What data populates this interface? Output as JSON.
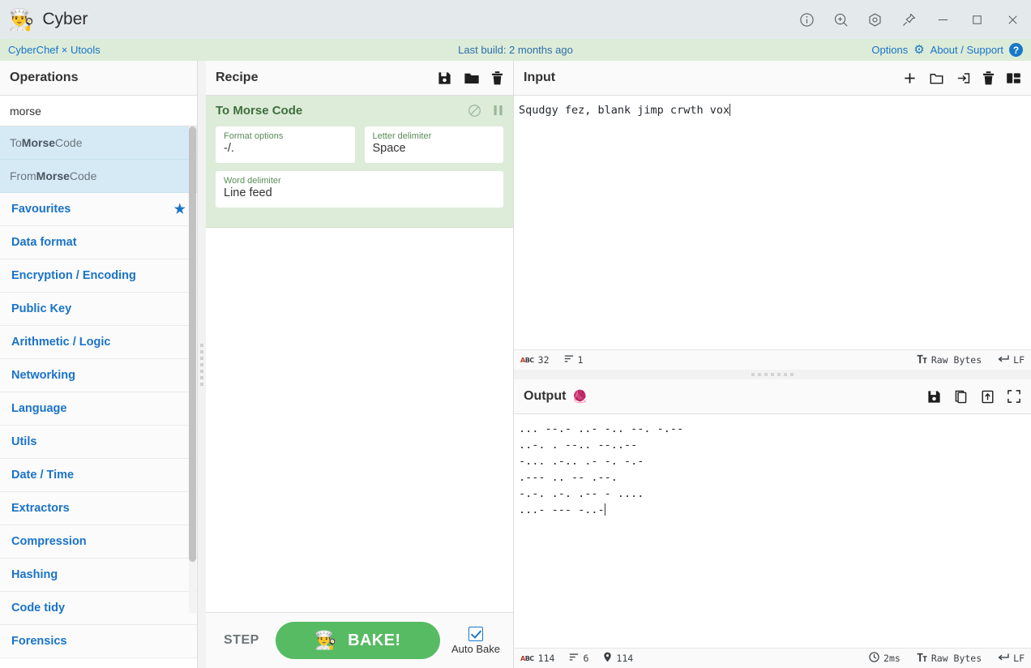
{
  "titlebar": {
    "app_name": "Cyber",
    "logo_icon": "chef-icon",
    "buttons": [
      {
        "name": "info-icon",
        "label": "Info"
      },
      {
        "name": "zoom-in-icon",
        "label": "Zoom"
      },
      {
        "name": "settings-icon",
        "label": "Settings"
      },
      {
        "name": "pin-icon",
        "label": "Pin"
      },
      {
        "name": "minimize-icon",
        "label": "Minimize"
      },
      {
        "name": "maximize-icon",
        "label": "Maximize"
      },
      {
        "name": "close-icon",
        "label": "Close"
      }
    ]
  },
  "subbar": {
    "brand": "CyberChef × Utools",
    "build": "Last build: 2 months ago",
    "options": "Options",
    "about": "About / Support",
    "background": "#ddecd9",
    "link_color": "#1a73c8"
  },
  "operations": {
    "title": "Operations",
    "search_value": "morse",
    "search_placeholder": "Search...",
    "results": [
      {
        "prefix": "To ",
        "match": "Morse",
        "suffix": " Code"
      },
      {
        "prefix": "From ",
        "match": "Morse",
        "suffix": " Code"
      }
    ],
    "categories": [
      {
        "label": "Favourites",
        "icon": "star-icon"
      },
      {
        "label": "Data format"
      },
      {
        "label": "Encryption / Encoding"
      },
      {
        "label": "Public Key"
      },
      {
        "label": "Arithmetic / Logic"
      },
      {
        "label": "Networking"
      },
      {
        "label": "Language"
      },
      {
        "label": "Utils"
      },
      {
        "label": "Date / Time"
      },
      {
        "label": "Extractors"
      },
      {
        "label": "Compression"
      },
      {
        "label": "Hashing"
      },
      {
        "label": "Code tidy"
      },
      {
        "label": "Forensics"
      }
    ]
  },
  "recipe": {
    "title": "Recipe",
    "icons": [
      {
        "name": "save-recipe-icon"
      },
      {
        "name": "load-recipe-icon"
      },
      {
        "name": "clear-recipe-icon"
      }
    ],
    "operation": {
      "name": "To Morse Code",
      "disable_icon": "disable-icon",
      "breakpoint_icon": "breakpoint-icon",
      "args": [
        {
          "label": "Format options",
          "value": "-/."
        },
        {
          "label": "Letter delimiter",
          "value": "Space"
        },
        {
          "label": "Word delimiter",
          "value": "Line feed"
        }
      ]
    },
    "controls": {
      "step": "STEP",
      "bake": "BAKE!",
      "bake_emoji": "chef-icon",
      "auto_bake": "Auto Bake",
      "auto_bake_checked": true,
      "bake_color": "#57bb63"
    }
  },
  "input": {
    "title": "Input",
    "icons": [
      {
        "name": "add-input-tab-icon"
      },
      {
        "name": "open-folder-icon"
      },
      {
        "name": "open-input-icon"
      },
      {
        "name": "clear-input-icon"
      },
      {
        "name": "reset-layout-icon"
      }
    ],
    "value": "Squdgy fez, blank jimp crwth vox",
    "status": {
      "length_icon": "abc-icon",
      "length": "32",
      "lines_icon": "lines-icon",
      "lines": "1",
      "encoding_icon": "font-icon",
      "encoding": "Raw Bytes",
      "eol_icon": "return-icon",
      "eol": "LF"
    }
  },
  "output": {
    "title": "Output",
    "magic_icon": "magic-wand-icon",
    "icons": [
      {
        "name": "save-output-icon"
      },
      {
        "name": "copy-output-icon"
      },
      {
        "name": "replace-input-icon"
      },
      {
        "name": "maximise-output-icon"
      }
    ],
    "lines": [
      "... --.- ..- -.. --. -.--",
      "..-. . --.. --..--",
      "-... .-.. .- -. -.-",
      ".--- .. -- .--.",
      "-.-. .-. .-- - ....",
      "...- --- -..-"
    ],
    "status": {
      "length_icon": "abc-icon",
      "length": "114",
      "lines_icon": "lines-icon",
      "lines": "6",
      "position_icon": "pin-marker-icon",
      "position": "114",
      "time_icon": "clock-icon",
      "time": "2ms",
      "encoding_icon": "font-icon",
      "encoding": "Raw Bytes",
      "eol_icon": "return-icon",
      "eol": "LF"
    }
  }
}
